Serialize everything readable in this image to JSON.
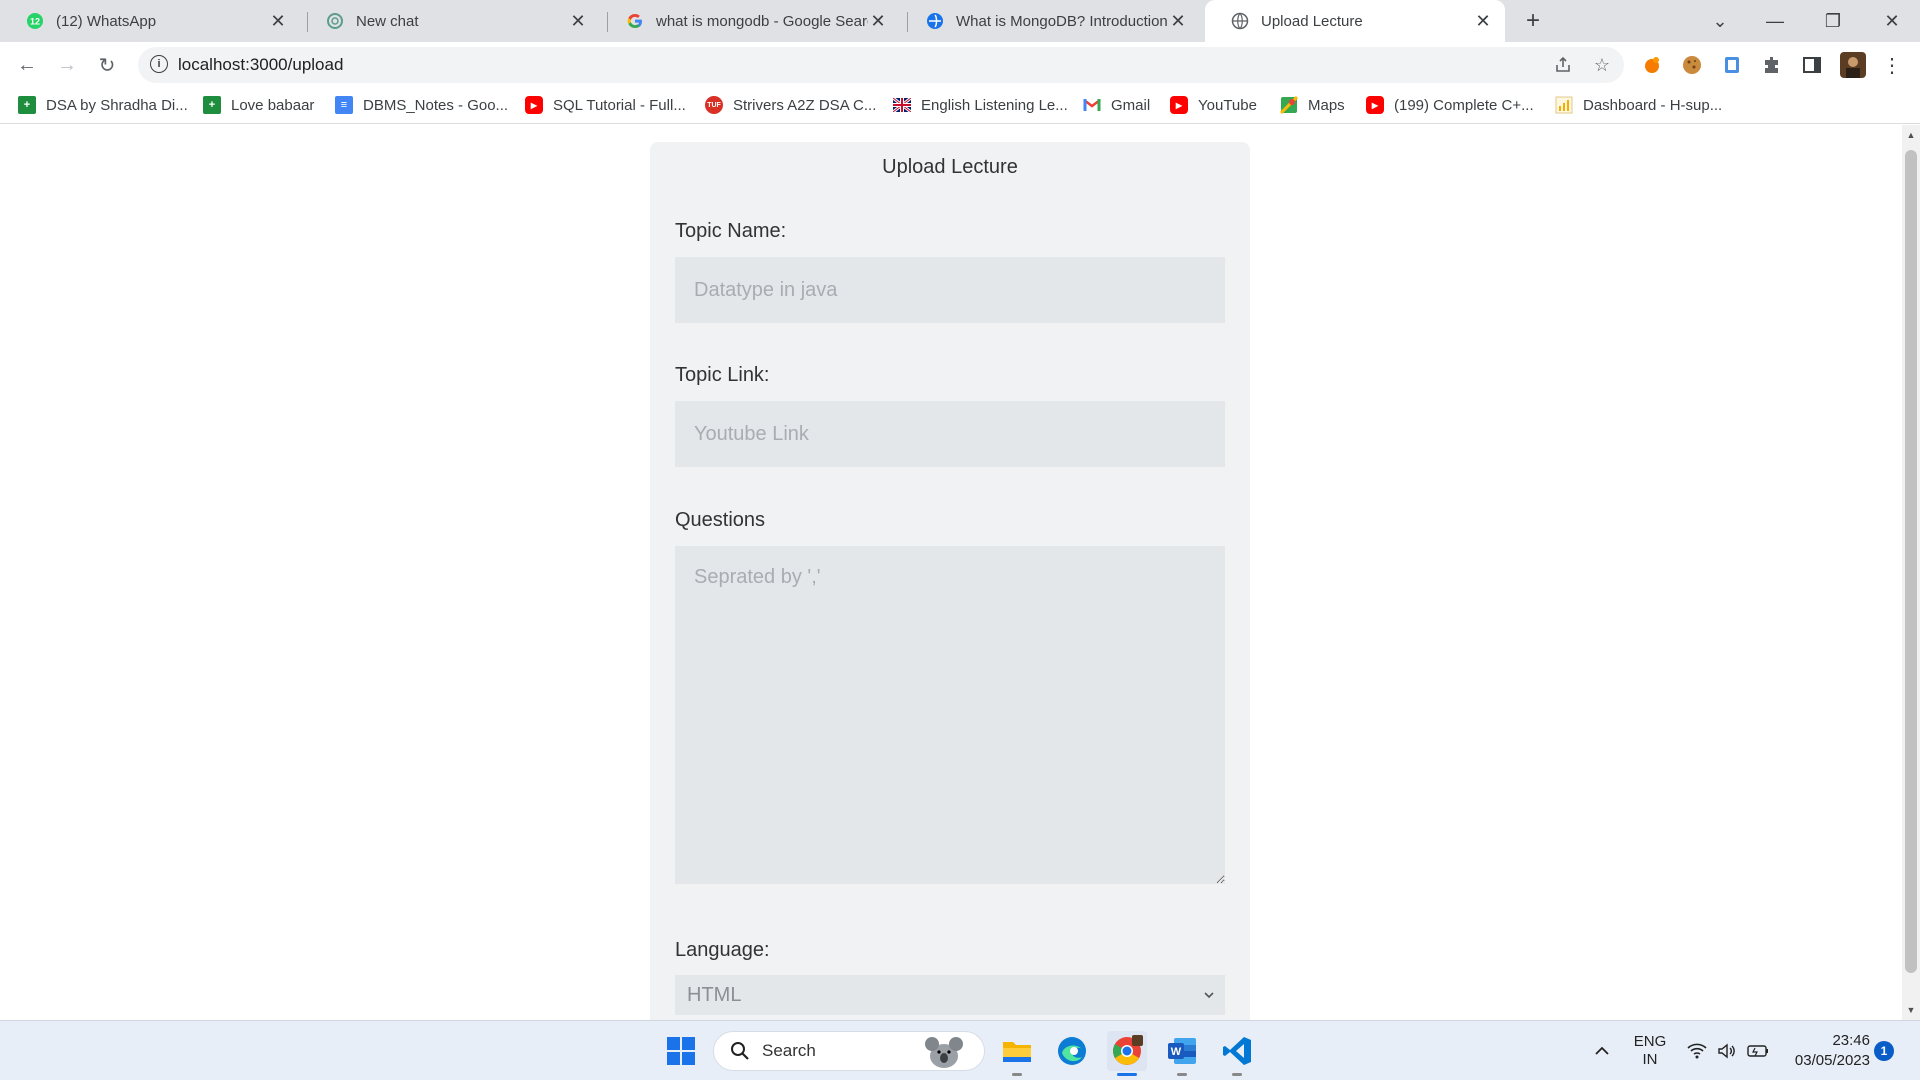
{
  "browser": {
    "tabs": [
      {
        "title": "(12) WhatsApp",
        "icon": "whatsapp-icon"
      },
      {
        "title": "New chat",
        "icon": "chatgpt-icon"
      },
      {
        "title": "what is mongodb - Google Searc",
        "icon": "google-icon"
      },
      {
        "title": "What is MongoDB? Introduction,",
        "icon": "globe-icon"
      },
      {
        "title": "Upload Lecture",
        "icon": "globe-icon",
        "active": true
      }
    ],
    "whatsapp_badge": "12",
    "address": "localhost:3000/upload",
    "bookmarks": [
      {
        "label": "DSA by Shradha Di...",
        "icon": "sheets-icon",
        "color": "#1e8e3e"
      },
      {
        "label": "Love babaar",
        "icon": "sheets-icon",
        "color": "#1e8e3e"
      },
      {
        "label": "DBMS_Notes - Goo...",
        "icon": "docs-icon",
        "color": "#4285f4"
      },
      {
        "label": "SQL Tutorial - Full...",
        "icon": "youtube-icon",
        "color": "#ff0000"
      },
      {
        "label": "Strivers A2Z DSA C...",
        "icon": "tuf-icon",
        "color": "#d93025"
      },
      {
        "label": "English Listening Le...",
        "icon": "uk-flag-icon",
        "color": "#012169"
      },
      {
        "label": "Gmail",
        "icon": "gmail-icon",
        "color": "#ea4335"
      },
      {
        "label": "YouTube",
        "icon": "youtube-icon",
        "color": "#ff0000"
      },
      {
        "label": "Maps",
        "icon": "maps-icon",
        "color": "#34a853"
      },
      {
        "label": "(199) Complete C+...",
        "icon": "youtube-icon",
        "color": "#ff0000"
      },
      {
        "label": "Dashboard - H-sup...",
        "icon": "chart-icon",
        "color": "#f9ab00"
      }
    ]
  },
  "form": {
    "title": "Upload Lecture",
    "topic_name_label": "Topic Name:",
    "topic_name_placeholder": "Datatype in java",
    "topic_link_label": "Topic Link:",
    "topic_link_placeholder": "Youtube Link",
    "questions_label": "Questions",
    "questions_placeholder": "Seprated by ','",
    "language_label": "Language:",
    "language_selected": "HTML"
  },
  "taskbar": {
    "search_label": "Search",
    "lang_top": "ENG",
    "lang_bottom": "IN",
    "time": "23:46",
    "date": "03/05/2023",
    "notification_count": "1"
  },
  "colors": {
    "card_bg": "#f0f2f3",
    "field_bg": "#e4e7e9",
    "tabstrip_bg": "#dfe1e5",
    "taskbar_bg": "#e8eef8"
  }
}
